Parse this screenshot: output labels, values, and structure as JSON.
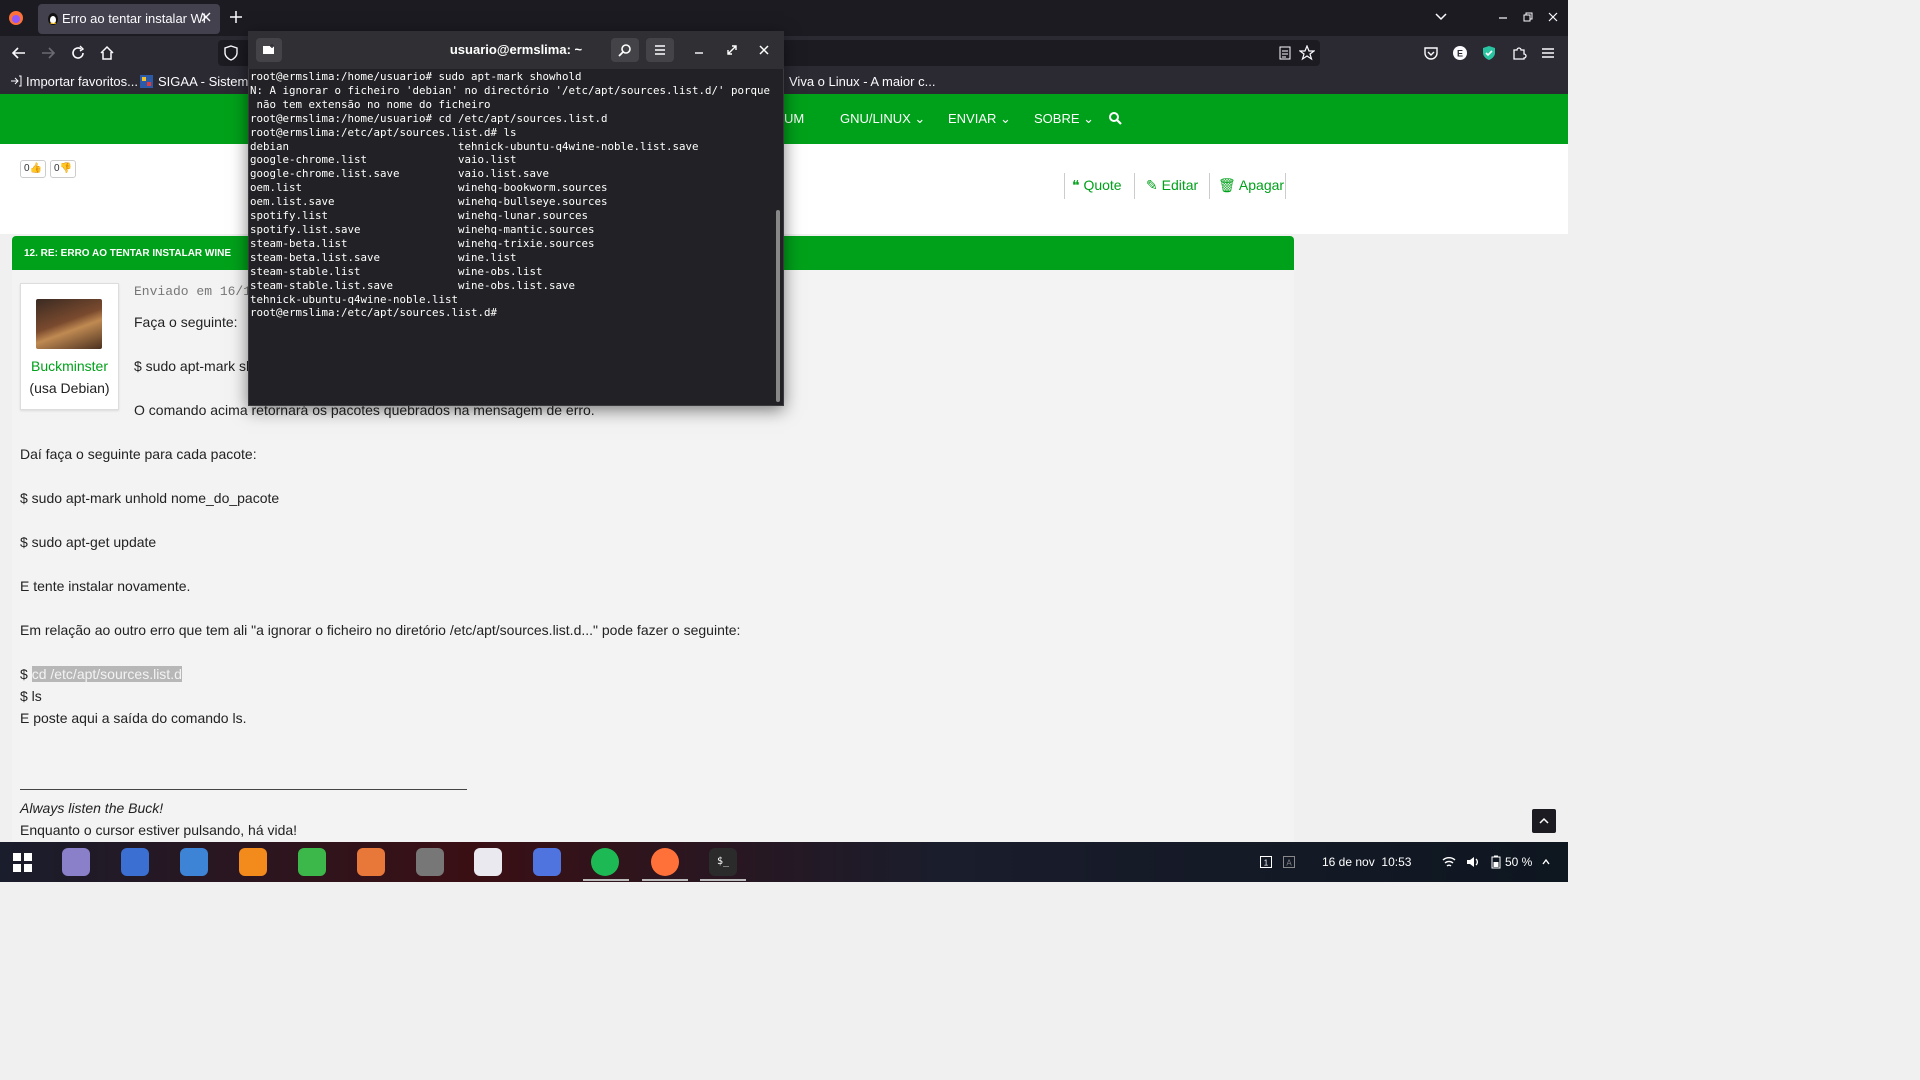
{
  "browser": {
    "tab_title": "Erro ao tentar instalar Wi",
    "bookmarks": [
      "Importar favoritos...",
      "SIGAA - Sistema",
      "Viva o Linux - A maior c..."
    ]
  },
  "site": {
    "nav": [
      "UM",
      "GNU/LINUX",
      "ENVIAR",
      "SOBRE"
    ],
    "votes": {
      "up": "0",
      "down": "0"
    },
    "actions": {
      "quote": "Quote",
      "edit": "Editar",
      "delete": "Apagar"
    }
  },
  "post": {
    "title": "12. RE: ERRO AO TENTAR INSTALAR WINE",
    "author": "Buckminster",
    "author_sub": "(usa Debian)",
    "sent": "Enviado em 16/1",
    "lines": {
      "l1": "Faça o seguinte:",
      "l2": "$ sudo apt-mark sh",
      "l3": "O comando acima retornará os pacotes quebrados na mensagem de erro.",
      "l4": "Daí faça o seguinte para cada pacote:",
      "l5": "$ sudo apt-mark unhold nome_do_pacote",
      "l6": "$ sudo apt-get update",
      "l7": "E tente instalar novamente.",
      "l8": "Em relação ao outro erro que tem ali \"a ignorar o ficheiro no diretório /etc/apt/sources.list.d...\" pode fazer o seguinte:",
      "l9_prefix": "$ ",
      "l9_highlight": "cd /etc/apt/sources.list.d",
      "l10": "$ ls",
      "l11": "E poste aqui a saída do comando ls."
    },
    "signature": {
      "line1": "Always listen the Buck!",
      "line2": "Enquanto o cursor estiver pulsando, há vida!"
    }
  },
  "terminal": {
    "title": "usuario@ermslima: ~",
    "content": "root@ermslima:/home/usuario# sudo apt-mark showhold\nN: A ignorar o ficheiro 'debian' no directório '/etc/apt/sources.list.d/' porque\n não tem extensão no nome do ficheiro\nroot@ermslima:/home/usuario# cd /etc/apt/sources.list.d\nroot@ermslima:/etc/apt/sources.list.d# ls\ndebian                          tehnick-ubuntu-q4wine-noble.list.save\ngoogle-chrome.list              vaio.list\ngoogle-chrome.list.save         vaio.list.save\noem.list                        winehq-bookworm.sources\noem.list.save                   winehq-bullseye.sources\nspotify.list                    winehq-lunar.sources\nspotify.list.save               winehq-mantic.sources\nsteam-beta.list                 winehq-trixie.sources\nsteam-beta.list.save            wine.list\nsteam-stable.list               wine-obs.list\nsteam-stable.list.save          wine-obs.list.save\ntehnick-ubuntu-q4wine-noble.list\nroot@ermslima:/etc/apt/sources.list.d#"
  },
  "taskbar": {
    "date": "16 de nov",
    "time": "10:53",
    "battery": "50 %",
    "apps": [
      "app-launcher",
      "files",
      "screenshot",
      "documents",
      "media-player",
      "spreadsheet",
      "presentation",
      "music",
      "mixer",
      "screen-capture",
      "spotify",
      "firefox",
      "terminal"
    ]
  },
  "colors": {
    "site_green": "#00a11a",
    "terminal_bg": "#222226",
    "browser_dark": "#1c1b22"
  }
}
